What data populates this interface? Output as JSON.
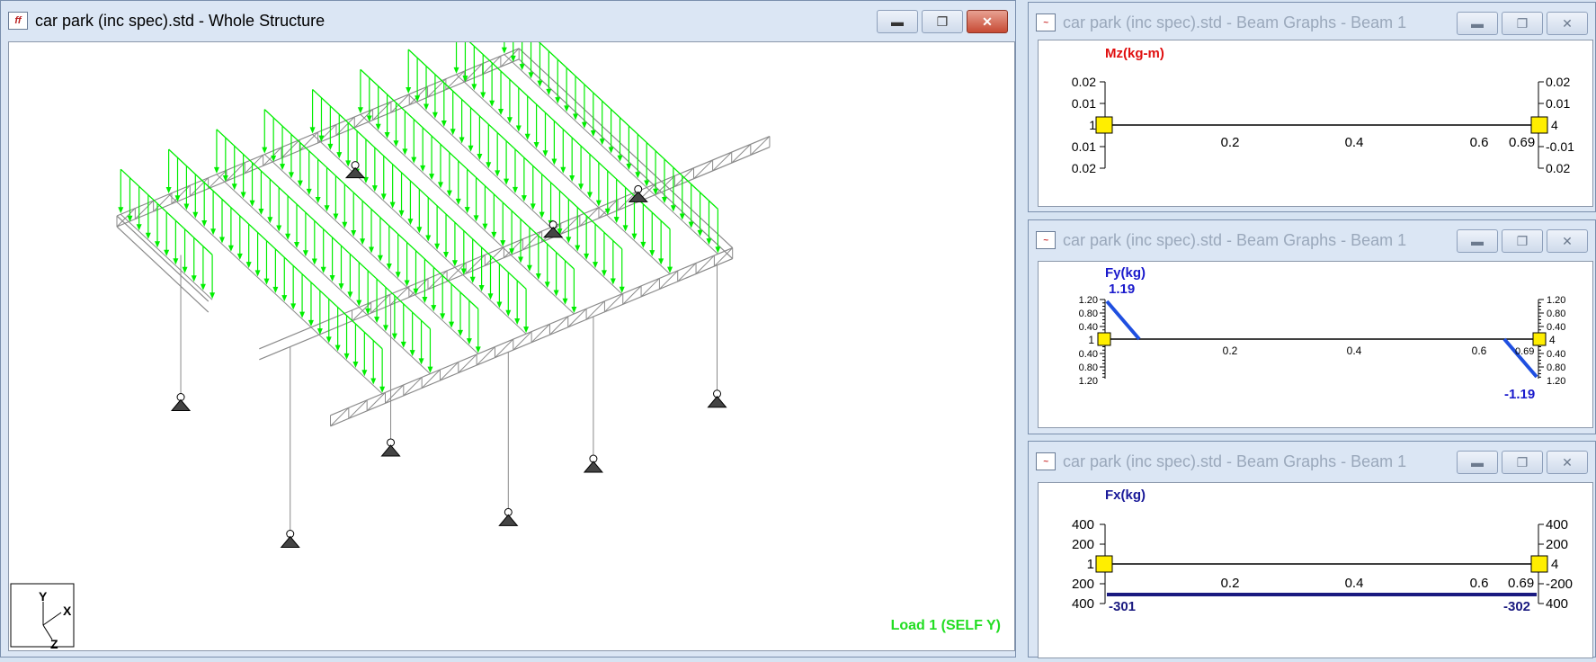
{
  "main_window": {
    "title": "car park (inc spec).std - Whole Structure",
    "app_icon": "staad-icon",
    "load_label": "Load 1 (SELF Y)",
    "axis_labels": {
      "y": "Y",
      "x": "X",
      "z": "Z"
    },
    "colors": {
      "load": "#00ee00",
      "frame": "#8a8a8a",
      "load_label": "#22dd22"
    }
  },
  "graph_windows": [
    {
      "title": "car park (inc spec).std - Beam Graphs - Beam 1",
      "quantity": "Mz(kg-m)",
      "quantity_color": "#e01010",
      "left_ticks": [
        "0.02",
        "0.01",
        "1",
        "0.01",
        "0.02"
      ],
      "right_ticks": [
        "0.02",
        "0.01",
        "4",
        "-0.01",
        "0.02"
      ],
      "x_ticks": [
        "0.2",
        "0.4",
        "0.6",
        "0.69"
      ],
      "node_start": "1",
      "node_end": "4"
    },
    {
      "title": "car park (inc spec).std - Beam Graphs - Beam 1",
      "quantity": "Fy(kg)",
      "quantity_color": "#1a1acc",
      "left_ticks": [
        "1.20",
        "0.80",
        "0.40",
        "1",
        "0.40",
        "0.80",
        "1.20"
      ],
      "right_ticks": [
        "1.20",
        "0.80",
        "0.40",
        "4",
        "0.40",
        "0.80",
        "1.20"
      ],
      "x_ticks": [
        "0.2",
        "0.4",
        "0.6",
        "0.69"
      ],
      "max_label": "1.19",
      "min_label": "-1.19",
      "node_start": "1",
      "node_end": "4"
    },
    {
      "title": "car park (inc spec).std - Beam Graphs - Beam 1",
      "quantity": "Fx(kg)",
      "quantity_color": "#1a1a99",
      "left_ticks": [
        "400",
        "200",
        "1",
        "200",
        "400"
      ],
      "right_ticks": [
        "400",
        "200",
        "4",
        "-200",
        "400"
      ],
      "x_ticks": [
        "0.2",
        "0.4",
        "0.6",
        "0.69"
      ],
      "start_value": "-301",
      "end_value": "-302",
      "node_start": "1",
      "node_end": "4"
    }
  ],
  "window_buttons": {
    "minimize": "minimize-icon",
    "restore": "restore-icon",
    "close": "close-icon"
  }
}
